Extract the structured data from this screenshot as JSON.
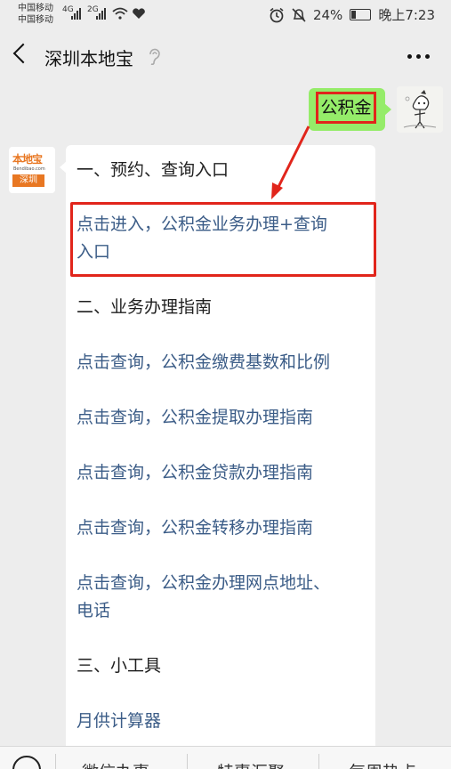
{
  "status_bar": {
    "carrier_1": "中国移动",
    "carrier_2": "中国移动",
    "network_1": "4G",
    "network_2": "2G",
    "battery": "24%",
    "time": "晚上7:23"
  },
  "nav": {
    "title": "深圳本地宝"
  },
  "messages": {
    "sent": "公积金",
    "bot_logo_text": "本地宝",
    "bot_logo_url": "Bendibao.com",
    "bot_logo_city": "深圳",
    "reply": {
      "section1": "一、预约、查询入口",
      "link1_line1": "点击进入，公积金业务办理+查询",
      "link1_line2": "入口",
      "section2": "二、业务办理指南",
      "link2": "点击查询，公积金缴费基数和比例",
      "link3": "点击查询，公积金提取办理指南",
      "link4": "点击查询，公积金贷款办理指南",
      "link5": "点击查询，公积金转移办理指南",
      "link6_line1": "点击查询，公积金办理网点地址、",
      "link6_line2": "电话",
      "section3": "三、小工具",
      "link7": "月供计算器"
    }
  },
  "bottom_menu": {
    "item1": "微信办事",
    "item2": "特惠汇聚",
    "item3": "每周热点"
  },
  "colors": {
    "sent_bubble": "#95ec69",
    "highlight": "#e1251b",
    "link": "#3b5c87",
    "logo_orange": "#e87722"
  }
}
